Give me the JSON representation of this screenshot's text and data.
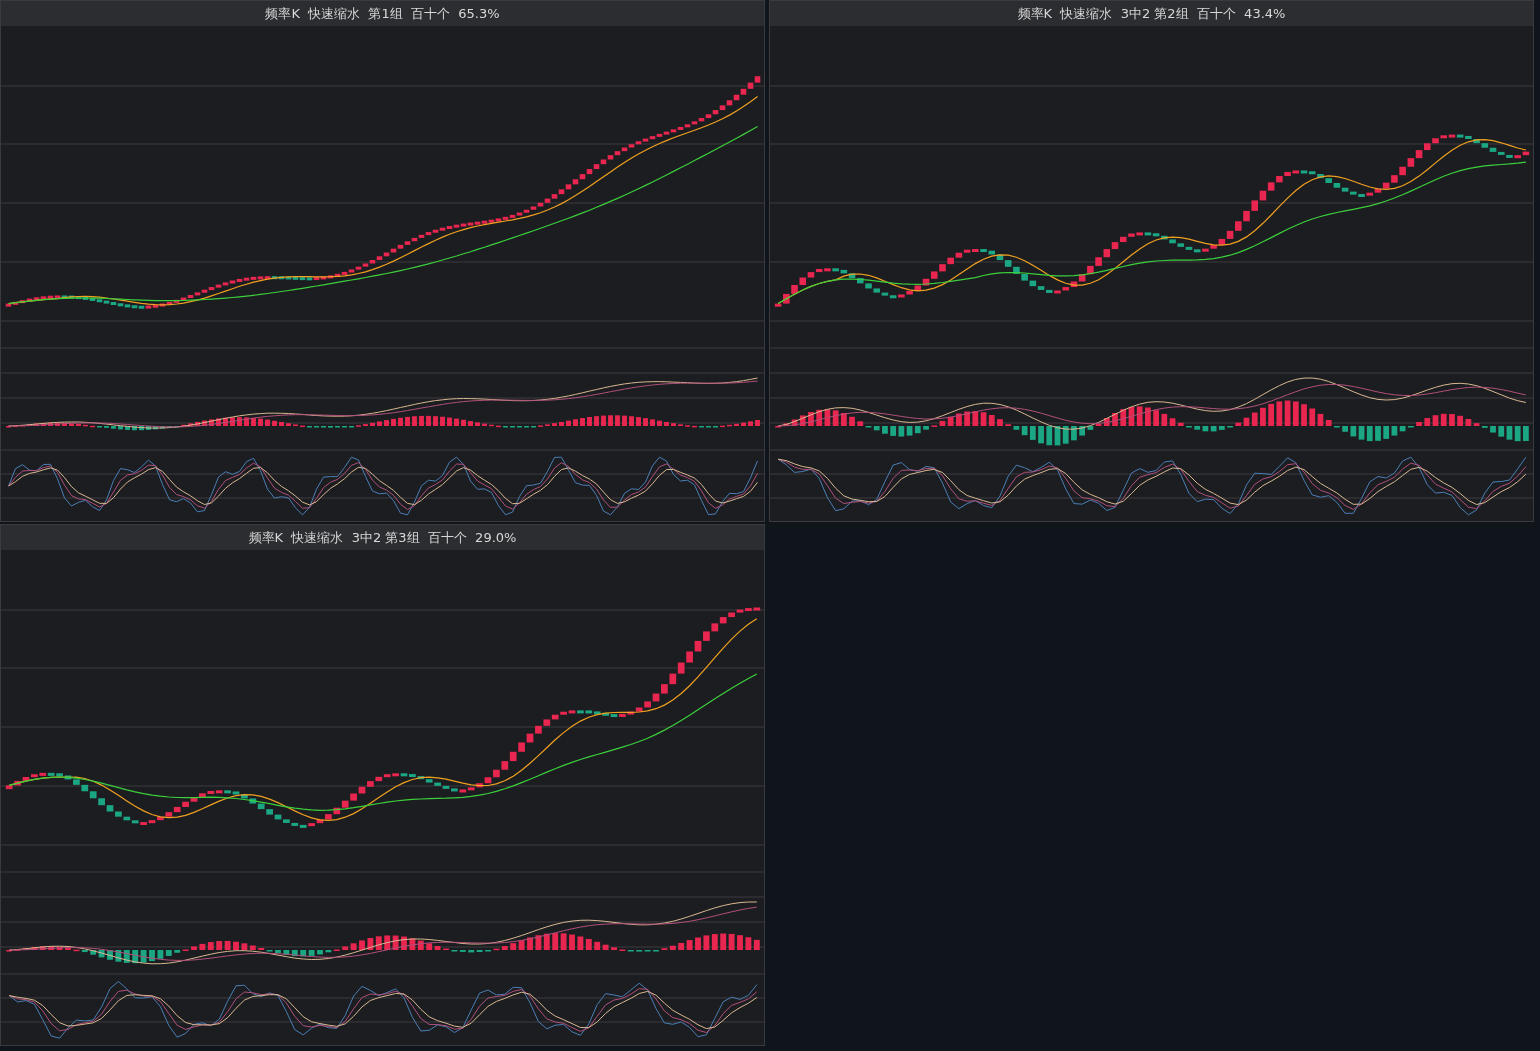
{
  "panels": [
    {
      "title": "频率K  快速缩水  第1组  百十个  65.3%"
    },
    {
      "title": "频率K  快速缩水  3中2 第2组  百十个  43.4%"
    },
    {
      "title": "频率K  快速缩水  3中2 第3组  百十个  29.0%"
    }
  ]
}
